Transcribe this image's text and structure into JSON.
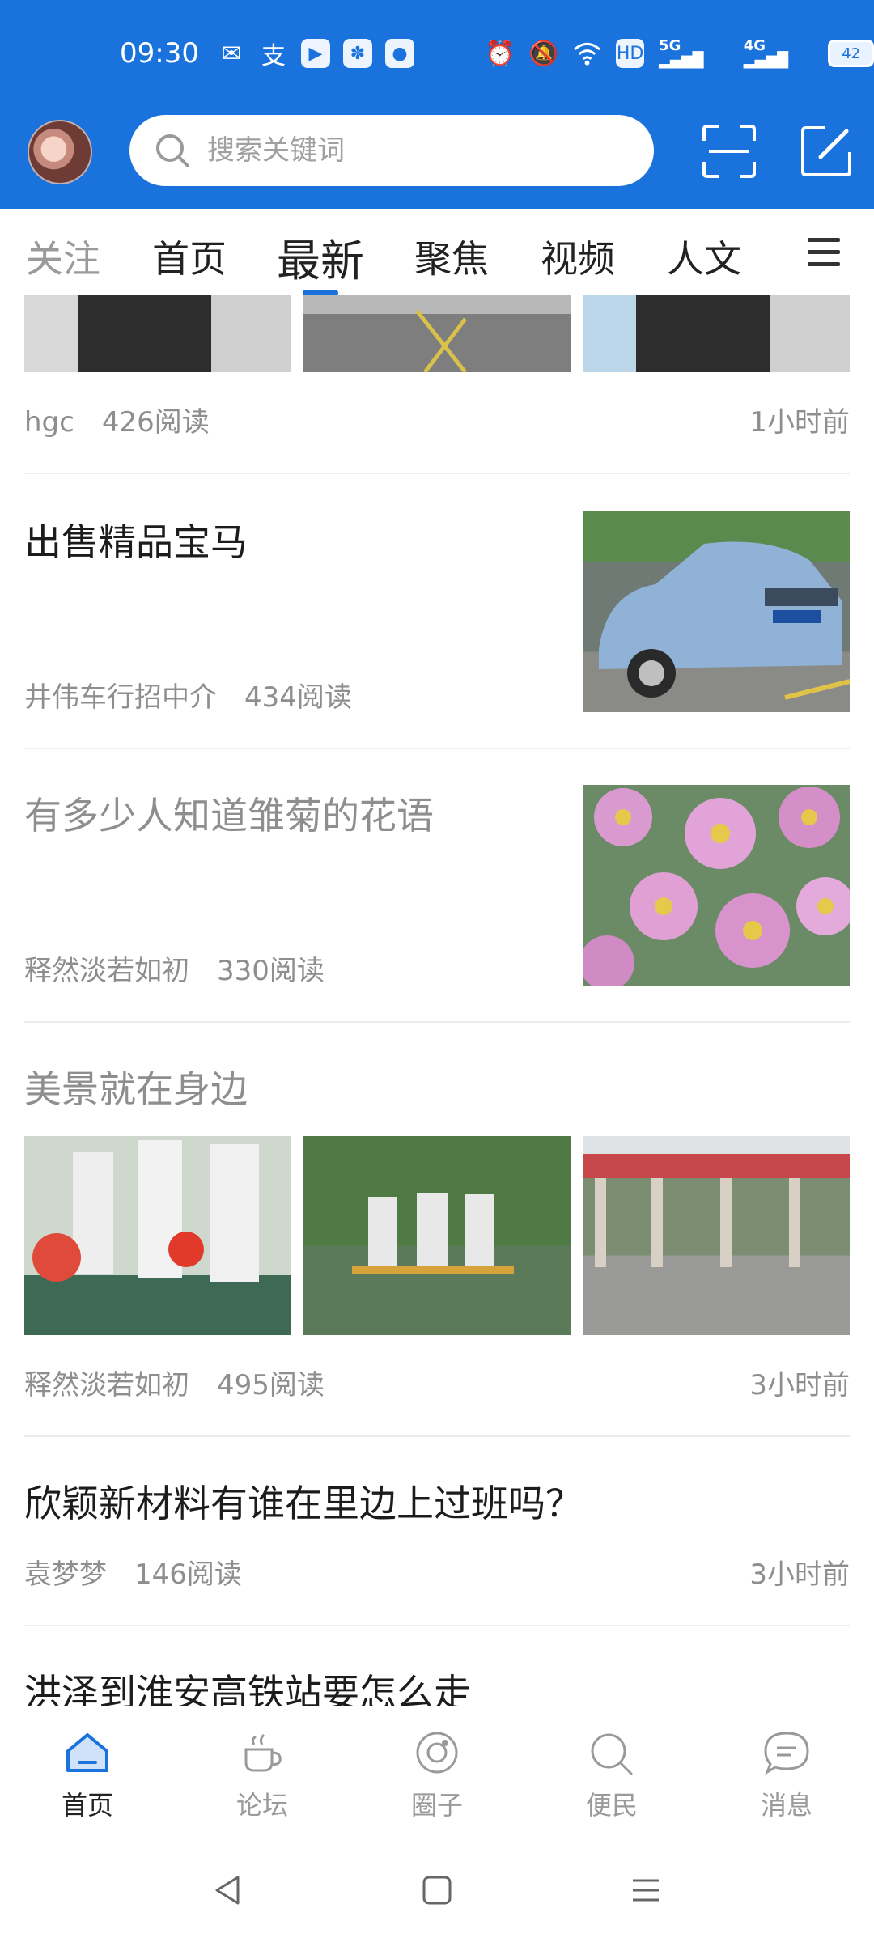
{
  "status_bar": {
    "time": "09:30",
    "network_1": "5G",
    "network_2": "4G",
    "hd": "HD",
    "battery": "42"
  },
  "header": {
    "search_placeholder": "搜索关键词"
  },
  "tabs": [
    {
      "label": "关注"
    },
    {
      "label": "首页"
    },
    {
      "label": "最新"
    },
    {
      "label": "聚焦"
    },
    {
      "label": "视频"
    },
    {
      "label": "人文"
    }
  ],
  "feed": {
    "item0": {
      "author": "hgc",
      "reads": "426阅读",
      "time": "1小时前"
    },
    "item1": {
      "title": "出售精品宝马",
      "author": "井伟车行招中介",
      "reads": "434阅读"
    },
    "item2": {
      "title": "有多少人知道雏菊的花语",
      "author": "释然淡若如初",
      "reads": "330阅读"
    },
    "item3": {
      "title": "美景就在身边",
      "author": "释然淡若如初",
      "reads": "495阅读",
      "time": "3小时前"
    },
    "item4": {
      "title": "欣颖新材料有谁在里边上过班吗？",
      "author": "袁梦梦",
      "reads": "146阅读",
      "time": "3小时前"
    },
    "item5": {
      "title": "洪泽到淮安高铁站要怎么走"
    }
  },
  "bottom_nav": [
    {
      "label": "首页"
    },
    {
      "label": "论坛"
    },
    {
      "label": "圈子"
    },
    {
      "label": "便民"
    },
    {
      "label": "消息"
    }
  ],
  "colors": {
    "brand": "#1a72dd",
    "muted_text": "#8e8e8e"
  }
}
